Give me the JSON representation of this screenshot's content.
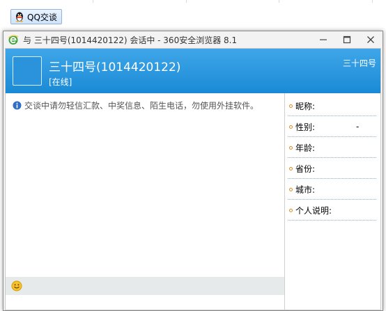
{
  "background": {
    "qq_chip_label": "QQ交谈"
  },
  "window": {
    "title": "与 三十四号(1014420122) 会话中 - 360安全浏览器 8.1",
    "buttons": {
      "minimize": "—",
      "maximize": "☐",
      "close": "✕"
    }
  },
  "header": {
    "name": "三十四号(1014420122)",
    "status": "[在线]",
    "right_label": "三十四号"
  },
  "chat": {
    "notice": "交谈中请勿轻信汇款、中奖信息、陌生电话，勿使用外挂软件。"
  },
  "profile": {
    "rows": [
      {
        "label": "昵称:",
        "value": ""
      },
      {
        "label": "性别:",
        "value": "-"
      },
      {
        "label": "年龄:",
        "value": ""
      },
      {
        "label": "省份:",
        "value": ""
      },
      {
        "label": "城市:",
        "value": ""
      },
      {
        "label": "个人说明:",
        "value": ""
      }
    ]
  },
  "colors": {
    "header_blue": "#1a8ad6",
    "bullet_orange": "#e08a1b"
  }
}
